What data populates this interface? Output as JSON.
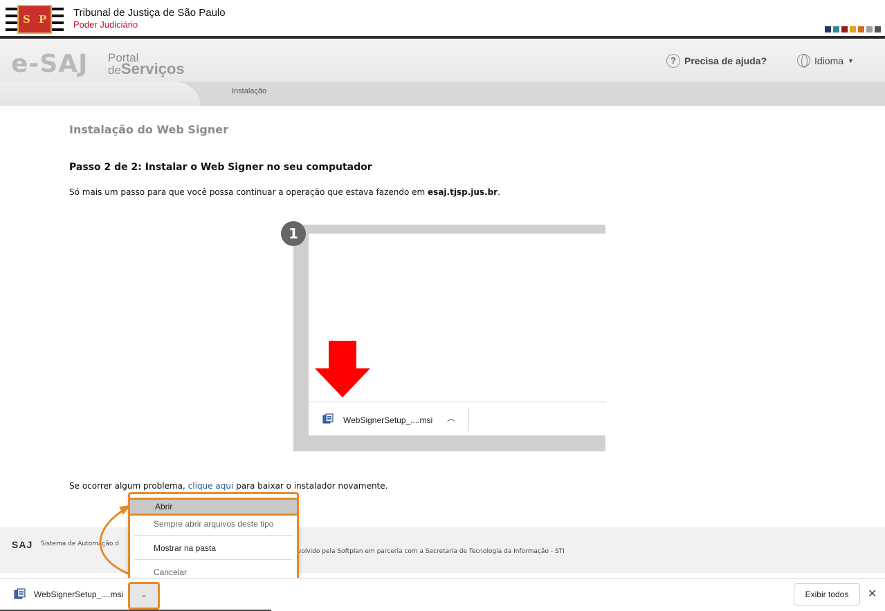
{
  "header": {
    "org_title": "Tribunal de Justiça de São Paulo",
    "org_subtitle": "Poder Judiciário",
    "logo_letters": [
      "S",
      "P"
    ],
    "colors": [
      "#1e3a5f",
      "#2a8a9a",
      "#9a1b1b",
      "#e8a020",
      "#d46a1a",
      "#9aa0a6",
      "#555555"
    ]
  },
  "esaj": {
    "logo_text": "e-SAJ",
    "portal_line1": "Portal",
    "portal_line2_small": "de",
    "portal_line2_big": "Serviços",
    "help_label": "Precisa de ajuda?",
    "language_label": "Idioma",
    "breadcrumb_tab": "Instalação"
  },
  "main": {
    "page_title": "Instalação do Web Signer",
    "step_title": "Passo 2 de 2: Instalar o Web Signer no seu computador",
    "step_text_before": "Só mais um passo para que você possa continuar a operação que estava fazendo em ",
    "step_text_bold": "esaj.tjsp.jus.br",
    "step_text_after": ".",
    "badge_number": "1",
    "illustration_file": "WebSignerSetup_....msi",
    "problem_before": "Se ocorrer algum problema, ",
    "problem_link": "clique aqui",
    "problem_after": " para baixar o instalador novamente."
  },
  "footer": {
    "saj": "SAJ",
    "system_text": "Sistema de Automação d",
    "dev_text": "volvido pela Softplan em parceria com a Secretaria de Tecnologia da Informação - STI"
  },
  "context_menu": {
    "items": [
      "Abrir",
      "Sempre abrir arquivos deste tipo",
      "Mostrar na pasta",
      "Cancelar"
    ]
  },
  "download_bar": {
    "file_name": "WebSignerSetup_....msi",
    "show_all": "Exibir todos",
    "close_symbol": "✕",
    "chevron_symbol": "⌄"
  },
  "icons": {
    "help": "question-icon",
    "language": "globe-icon",
    "download_file": "msi-installer-icon",
    "arrow": "red-down-arrow-icon"
  }
}
